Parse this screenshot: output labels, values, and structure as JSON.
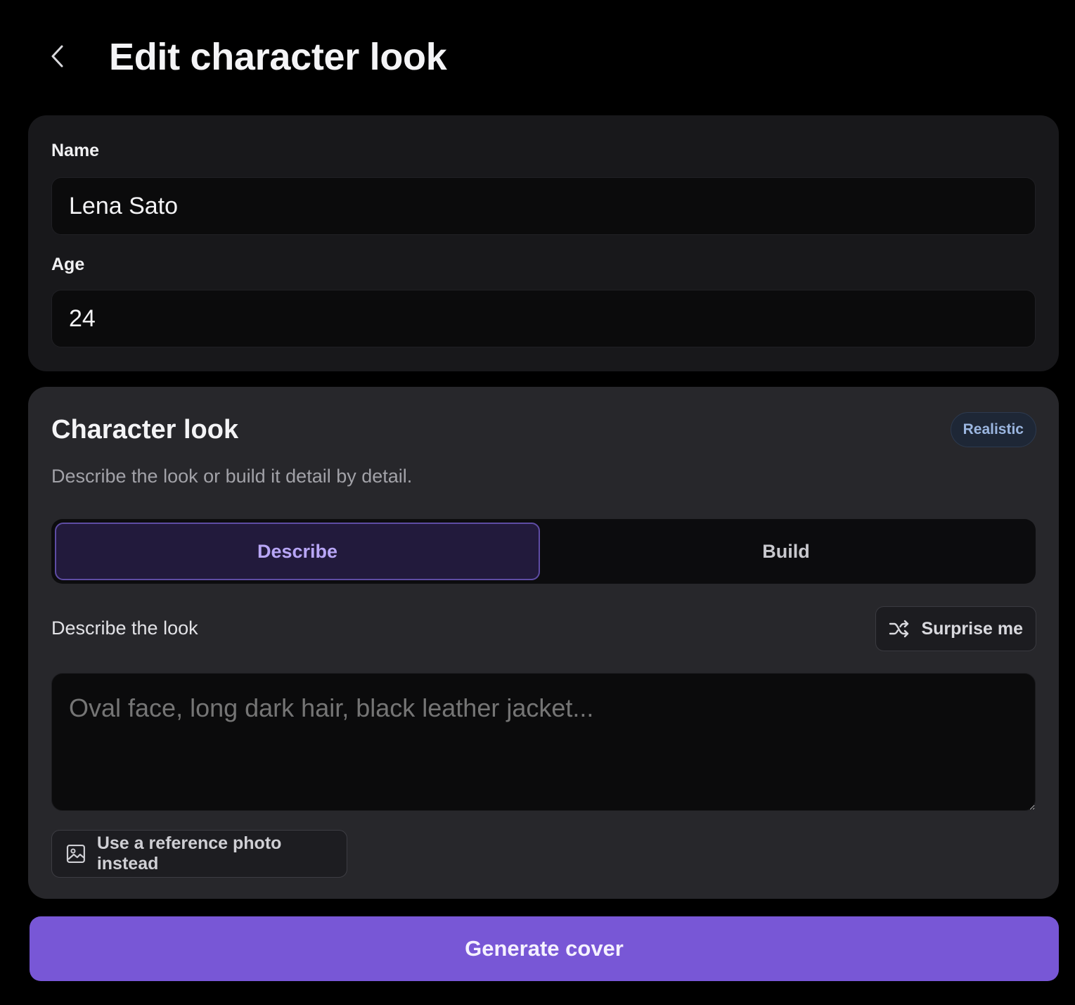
{
  "header": {
    "title": "Edit character look",
    "back_icon": "chevron-left-icon"
  },
  "details": {
    "name_label": "Name",
    "name_value": "Lena Sato",
    "age_label": "Age",
    "age_value": "24"
  },
  "look": {
    "title": "Character look",
    "style_badge": "Realistic",
    "subtitle": "Describe the look or build it detail by detail.",
    "tabs": [
      {
        "label": "Describe",
        "active": true
      },
      {
        "label": "Build",
        "active": false
      }
    ],
    "describe_label": "Describe the look",
    "surprise_label": "Surprise me",
    "surprise_icon": "shuffle-icon",
    "description_placeholder": "Oval face, long dark hair, black leather jacket...",
    "description_value": "",
    "reference_label": "Use a reference photo instead",
    "reference_icon": "image-icon"
  },
  "footer": {
    "generate_label": "Generate cover"
  },
  "colors": {
    "background": "#000000",
    "card": "#27272b",
    "accent": "#7857d6",
    "active_tab_text": "#b8a6f6",
    "badge_text": "#9bb6e0"
  }
}
